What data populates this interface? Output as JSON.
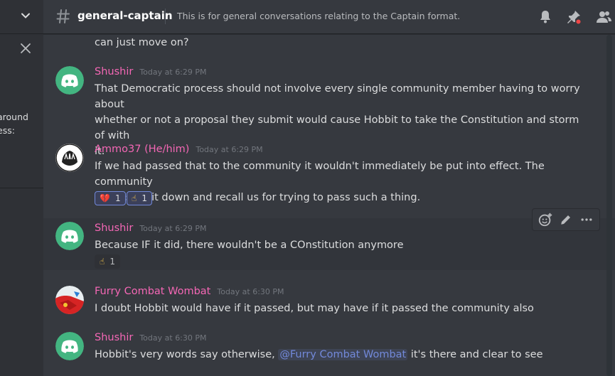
{
  "left_panel": {
    "snippets": [
      "around",
      "ess:"
    ]
  },
  "header": {
    "channel_name": "general-captain",
    "topic": "This is for general conversations relating to the Captain format."
  },
  "messages": [
    {
      "text": "can just move on?"
    },
    {
      "author": "Shushir",
      "timestamp": "Today at 6:29 PM",
      "author_color": "#f467b5",
      "lines": [
        "That Democratic process should not involve every single community member having to worry about",
        "whether or not a proposal they submit would cause Hobbit to take the Constitution and storm of with",
        "it."
      ]
    },
    {
      "author": "Ammo37 (He/him)",
      "timestamp": "Today at 6:29 PM",
      "author_color": "#f467b5",
      "lines": [
        "If we had passed that to the community it wouldn't immediately be put into effect. The community",
        "could shut it down and recall us for trying to pass such a thing."
      ],
      "reactions": [
        {
          "emoji": "💔",
          "count": "1"
        },
        {
          "emoji": "☝",
          "count": "1"
        }
      ]
    },
    {
      "author": "Shushir",
      "timestamp": "Today at 6:29 PM",
      "author_color": "#f467b5",
      "lines": [
        "Because IF it did, there wouldn't be a COnstitution anymore"
      ],
      "reactions": [
        {
          "emoji": "☝",
          "count": "1"
        }
      ]
    },
    {
      "author": "Furry Combat Wombat",
      "timestamp": "Today at 6:30 PM",
      "author_color": "#f467b5",
      "lines": [
        "I doubt Hobbit would have if it passed, but may have if it passed the community also"
      ]
    },
    {
      "author": "Shushir",
      "timestamp": "Today at 6:30 PM",
      "author_color": "#f467b5",
      "text_before": "Hobbit's very words say otherwise, ",
      "mention": "@Furry Combat Wombat",
      "text_after": " it's there and clear to see"
    }
  ],
  "colors": {
    "accent": "#7289da",
    "discord_blurple": "#7289da",
    "background": "#36393f"
  }
}
